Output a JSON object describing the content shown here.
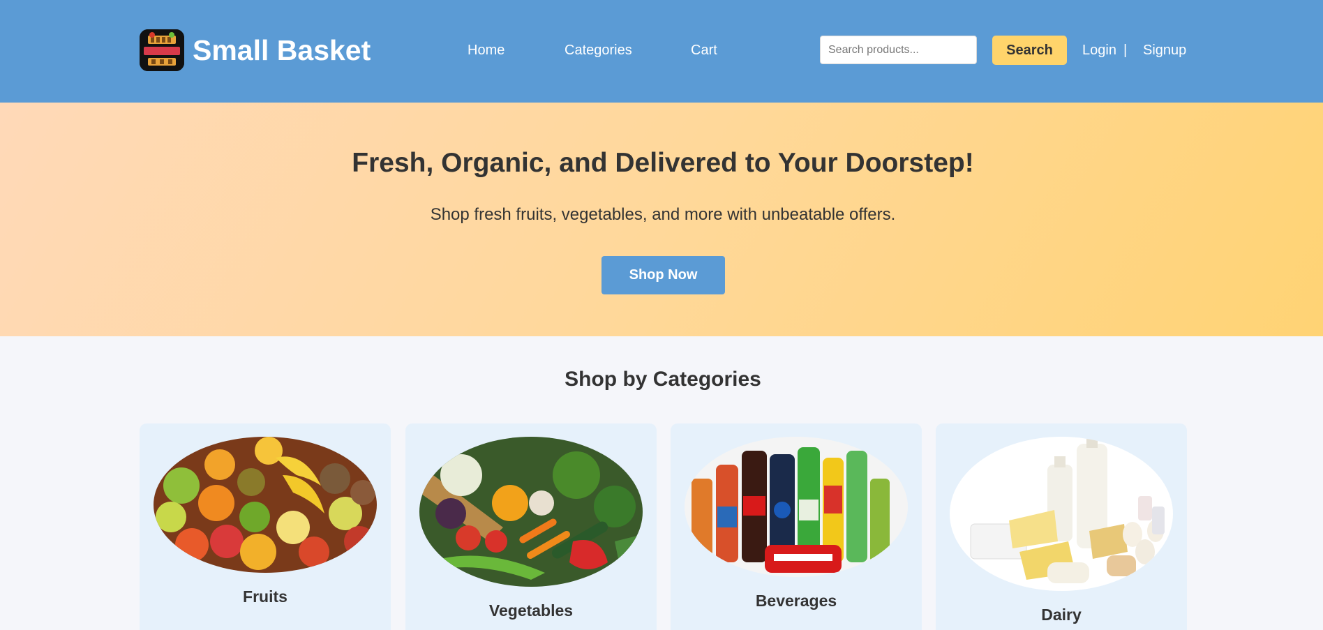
{
  "header": {
    "brand": "Small Basket",
    "logo_icon": "small-basket-logo",
    "nav": {
      "home": "Home",
      "categories": "Categories",
      "cart": "Cart"
    },
    "search": {
      "placeholder": "Search products...",
      "button": "Search"
    },
    "auth": {
      "login": "Login",
      "separator": "|",
      "signup": "Signup"
    },
    "colors": {
      "bar": "#5b9bd5",
      "search_button": "#ffd46b"
    }
  },
  "hero": {
    "title": "Fresh, Organic, and Delivered to Your Doorstep!",
    "subtitle": "Shop fresh fruits, vegetables, and more with unbeatable offers.",
    "cta": "Shop Now"
  },
  "categories": {
    "title": "Shop by Categories",
    "items": [
      {
        "label": "Fruits",
        "image": "fruits-image"
      },
      {
        "label": "Vegetables",
        "image": "vegetables-image"
      },
      {
        "label": "Beverages",
        "image": "beverages-image"
      },
      {
        "label": "Dairy",
        "image": "dairy-image"
      }
    ]
  }
}
